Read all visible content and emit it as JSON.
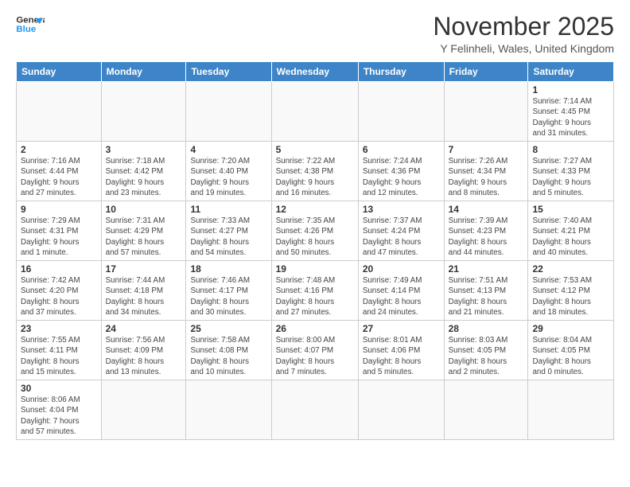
{
  "logo": {
    "line1": "General",
    "line2": "Blue"
  },
  "title": "November 2025",
  "location": "Y Felinheli, Wales, United Kingdom",
  "weekdays": [
    "Sunday",
    "Monday",
    "Tuesday",
    "Wednesday",
    "Thursday",
    "Friday",
    "Saturday"
  ],
  "days": [
    {
      "num": "",
      "info": ""
    },
    {
      "num": "",
      "info": ""
    },
    {
      "num": "",
      "info": ""
    },
    {
      "num": "",
      "info": ""
    },
    {
      "num": "",
      "info": ""
    },
    {
      "num": "",
      "info": ""
    },
    {
      "num": "1",
      "info": "Sunrise: 7:14 AM\nSunset: 4:45 PM\nDaylight: 9 hours\nand 31 minutes."
    },
    {
      "num": "2",
      "info": "Sunrise: 7:16 AM\nSunset: 4:44 PM\nDaylight: 9 hours\nand 27 minutes."
    },
    {
      "num": "3",
      "info": "Sunrise: 7:18 AM\nSunset: 4:42 PM\nDaylight: 9 hours\nand 23 minutes."
    },
    {
      "num": "4",
      "info": "Sunrise: 7:20 AM\nSunset: 4:40 PM\nDaylight: 9 hours\nand 19 minutes."
    },
    {
      "num": "5",
      "info": "Sunrise: 7:22 AM\nSunset: 4:38 PM\nDaylight: 9 hours\nand 16 minutes."
    },
    {
      "num": "6",
      "info": "Sunrise: 7:24 AM\nSunset: 4:36 PM\nDaylight: 9 hours\nand 12 minutes."
    },
    {
      "num": "7",
      "info": "Sunrise: 7:26 AM\nSunset: 4:34 PM\nDaylight: 9 hours\nand 8 minutes."
    },
    {
      "num": "8",
      "info": "Sunrise: 7:27 AM\nSunset: 4:33 PM\nDaylight: 9 hours\nand 5 minutes."
    },
    {
      "num": "9",
      "info": "Sunrise: 7:29 AM\nSunset: 4:31 PM\nDaylight: 9 hours\nand 1 minute."
    },
    {
      "num": "10",
      "info": "Sunrise: 7:31 AM\nSunset: 4:29 PM\nDaylight: 8 hours\nand 57 minutes."
    },
    {
      "num": "11",
      "info": "Sunrise: 7:33 AM\nSunset: 4:27 PM\nDaylight: 8 hours\nand 54 minutes."
    },
    {
      "num": "12",
      "info": "Sunrise: 7:35 AM\nSunset: 4:26 PM\nDaylight: 8 hours\nand 50 minutes."
    },
    {
      "num": "13",
      "info": "Sunrise: 7:37 AM\nSunset: 4:24 PM\nDaylight: 8 hours\nand 47 minutes."
    },
    {
      "num": "14",
      "info": "Sunrise: 7:39 AM\nSunset: 4:23 PM\nDaylight: 8 hours\nand 44 minutes."
    },
    {
      "num": "15",
      "info": "Sunrise: 7:40 AM\nSunset: 4:21 PM\nDaylight: 8 hours\nand 40 minutes."
    },
    {
      "num": "16",
      "info": "Sunrise: 7:42 AM\nSunset: 4:20 PM\nDaylight: 8 hours\nand 37 minutes."
    },
    {
      "num": "17",
      "info": "Sunrise: 7:44 AM\nSunset: 4:18 PM\nDaylight: 8 hours\nand 34 minutes."
    },
    {
      "num": "18",
      "info": "Sunrise: 7:46 AM\nSunset: 4:17 PM\nDaylight: 8 hours\nand 30 minutes."
    },
    {
      "num": "19",
      "info": "Sunrise: 7:48 AM\nSunset: 4:16 PM\nDaylight: 8 hours\nand 27 minutes."
    },
    {
      "num": "20",
      "info": "Sunrise: 7:49 AM\nSunset: 4:14 PM\nDaylight: 8 hours\nand 24 minutes."
    },
    {
      "num": "21",
      "info": "Sunrise: 7:51 AM\nSunset: 4:13 PM\nDaylight: 8 hours\nand 21 minutes."
    },
    {
      "num": "22",
      "info": "Sunrise: 7:53 AM\nSunset: 4:12 PM\nDaylight: 8 hours\nand 18 minutes."
    },
    {
      "num": "23",
      "info": "Sunrise: 7:55 AM\nSunset: 4:11 PM\nDaylight: 8 hours\nand 15 minutes."
    },
    {
      "num": "24",
      "info": "Sunrise: 7:56 AM\nSunset: 4:09 PM\nDaylight: 8 hours\nand 13 minutes."
    },
    {
      "num": "25",
      "info": "Sunrise: 7:58 AM\nSunset: 4:08 PM\nDaylight: 8 hours\nand 10 minutes."
    },
    {
      "num": "26",
      "info": "Sunrise: 8:00 AM\nSunset: 4:07 PM\nDaylight: 8 hours\nand 7 minutes."
    },
    {
      "num": "27",
      "info": "Sunrise: 8:01 AM\nSunset: 4:06 PM\nDaylight: 8 hours\nand 5 minutes."
    },
    {
      "num": "28",
      "info": "Sunrise: 8:03 AM\nSunset: 4:05 PM\nDaylight: 8 hours\nand 2 minutes."
    },
    {
      "num": "29",
      "info": "Sunrise: 8:04 AM\nSunset: 4:05 PM\nDaylight: 8 hours\nand 0 minutes."
    },
    {
      "num": "30",
      "info": "Sunrise: 8:06 AM\nSunset: 4:04 PM\nDaylight: 7 hours\nand 57 minutes."
    },
    {
      "num": "",
      "info": ""
    },
    {
      "num": "",
      "info": ""
    },
    {
      "num": "",
      "info": ""
    },
    {
      "num": "",
      "info": ""
    },
    {
      "num": "",
      "info": ""
    },
    {
      "num": "",
      "info": ""
    }
  ]
}
